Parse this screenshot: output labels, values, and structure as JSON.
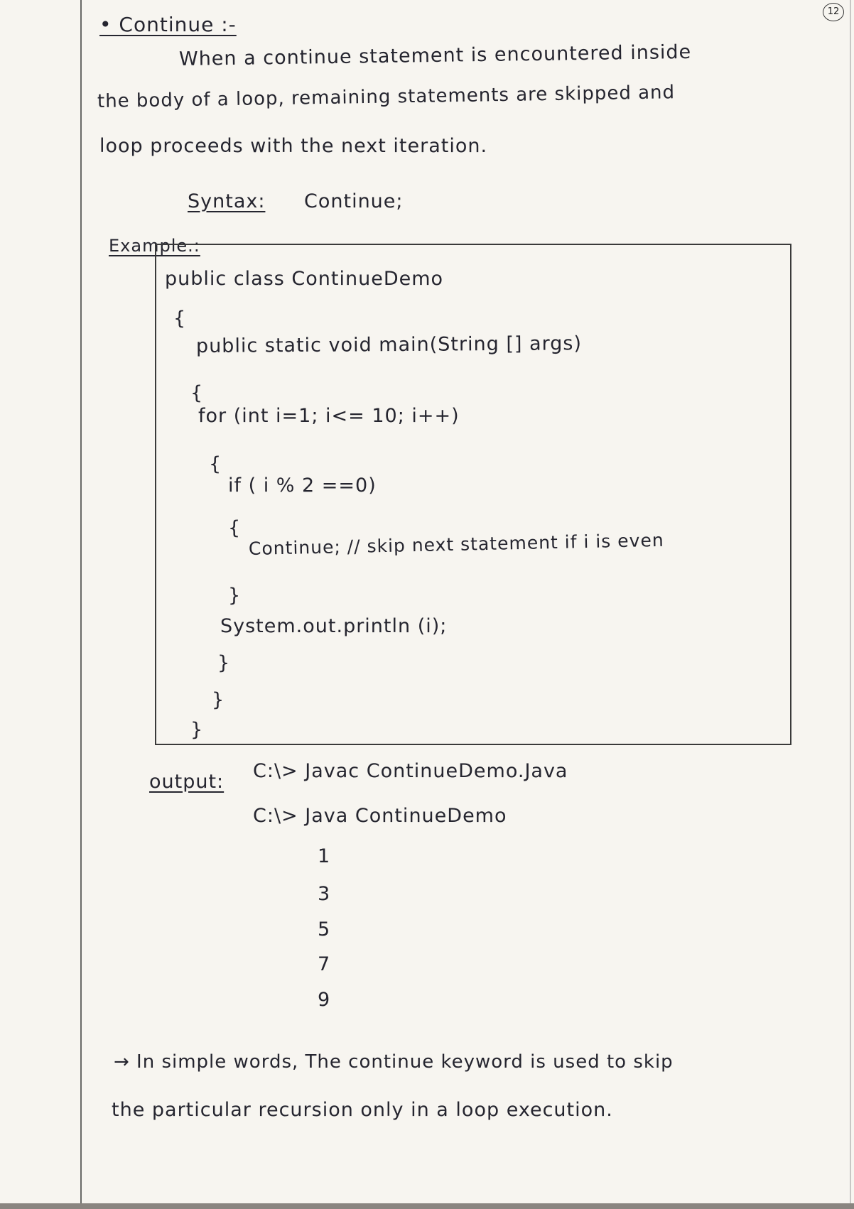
{
  "page_number": "12",
  "heading": "• Continue :-",
  "definition": [
    "When a continue statement is encountered inside",
    "the body of a loop, remaining statements are skipped and",
    "loop proceeds with the next iteration."
  ],
  "syntax": {
    "label": "Syntax:",
    "value": "Continue;"
  },
  "example_label": "Example.:",
  "code": [
    "public class ContinueDemo",
    "{",
    "public static void main(String [] args)",
    "{",
    "for (int i=1; i<= 10; i++)",
    "{",
    "if ( i % 2 ==0)",
    "{",
    "Continue; // skip next statement if i is even",
    "}",
    "System.out.println (i);",
    "}",
    "}",
    "}"
  ],
  "output": {
    "label": "output:",
    "commands": [
      "C:\\> Javac ContinueDemo.Java",
      "C:\\> Java ContinueDemo"
    ],
    "values": [
      "1",
      "3",
      "5",
      "7",
      "9"
    ]
  },
  "summary": [
    "→ In simple words, The continue keyword is used to skip",
    "the particular recursion only in a loop execution."
  ]
}
